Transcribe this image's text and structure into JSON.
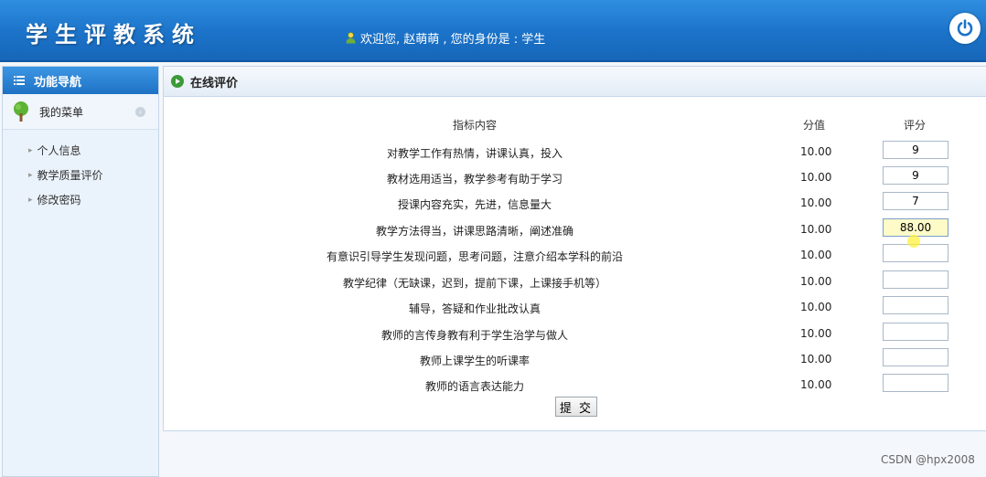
{
  "header": {
    "title": "学生评教系统",
    "welcome": "欢迎您, 赵萌萌 , 您的身份是 : 学生",
    "user_icon": "user-icon",
    "logout_icon": "power-icon"
  },
  "sidebar": {
    "header": "功能导航",
    "menu_label": "我的菜单",
    "items": [
      {
        "label": "个人信息"
      },
      {
        "label": "教学质量评价"
      },
      {
        "label": "修改密码"
      }
    ]
  },
  "main": {
    "title": "在线评价",
    "columns": {
      "indicator": "指标内容",
      "max": "分值",
      "score": "评分"
    },
    "rows": [
      {
        "indicator": "对教学工作有热情，讲课认真，投入",
        "max": "10.00",
        "score": "9"
      },
      {
        "indicator": "教材选用适当，教学参考有助于学习",
        "max": "10.00",
        "score": "9"
      },
      {
        "indicator": "授课内容充实，先进，信息量大",
        "max": "10.00",
        "score": "7"
      },
      {
        "indicator": "教学方法得当，讲课思路清晰，阐述准确",
        "max": "10.00",
        "score": "88.00"
      },
      {
        "indicator": "有意识引导学生发现问题，思考问题，注意介绍本学科的前沿",
        "max": "10.00",
        "score": ""
      },
      {
        "indicator": "教学纪律（无缺课，迟到，提前下课，上课接手机等）",
        "max": "10.00",
        "score": ""
      },
      {
        "indicator": "辅导，答疑和作业批改认真",
        "max": "10.00",
        "score": ""
      },
      {
        "indicator": "教师的言传身教有利于学生治学与做人",
        "max": "10.00",
        "score": ""
      },
      {
        "indicator": "教师上课学生的听课率",
        "max": "10.00",
        "score": ""
      },
      {
        "indicator": "教师的语言表达能力",
        "max": "10.00",
        "score": ""
      }
    ],
    "submit_label": "提 交"
  },
  "watermark": "CSDN @hpx2008",
  "colors": {
    "header_blue": "#1b73c9",
    "active_input": "#fffbc8"
  }
}
